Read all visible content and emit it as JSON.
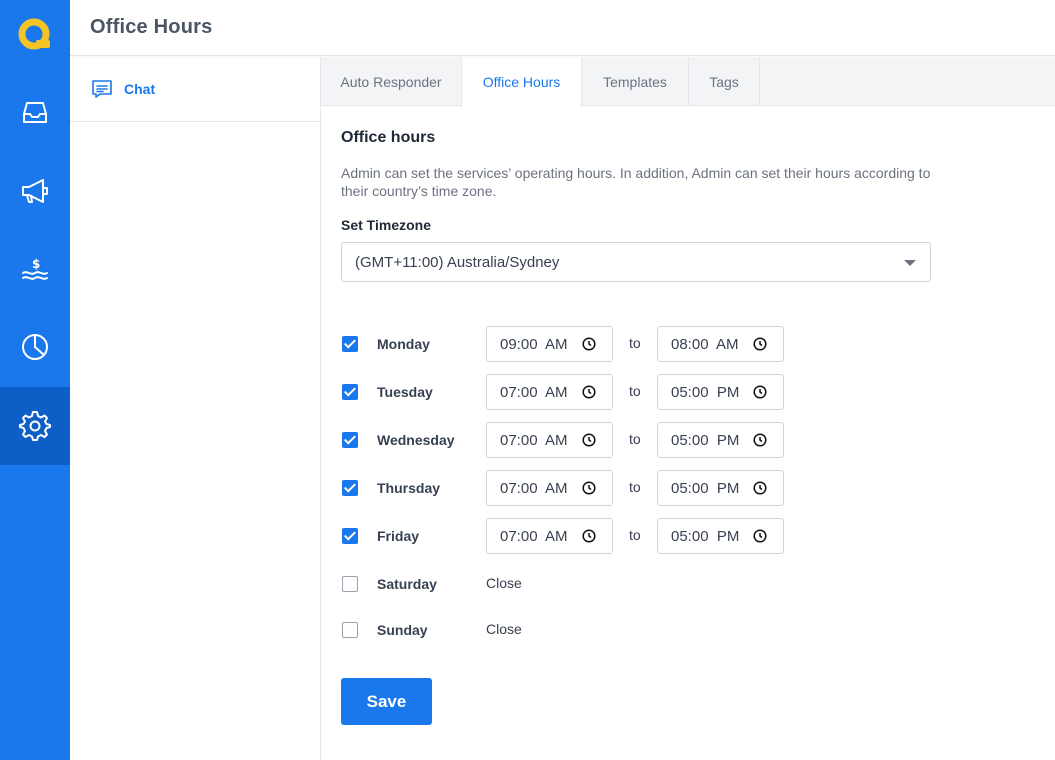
{
  "header": {
    "title": "Office Hours"
  },
  "rail": {
    "items": [
      {
        "icon": "inbox-icon"
      },
      {
        "icon": "megaphone-icon"
      },
      {
        "icon": "billing-icon"
      },
      {
        "icon": "pie-chart-icon"
      },
      {
        "icon": "gear-icon",
        "active": true
      }
    ]
  },
  "subnav": {
    "chat_label": "Chat"
  },
  "tabs": [
    {
      "label": "Auto Responder"
    },
    {
      "label": "Office Hours",
      "active": true
    },
    {
      "label": "Templates"
    },
    {
      "label": "Tags"
    }
  ],
  "main": {
    "title": "Office hours",
    "description": "Admin can set the services’ operating hours. In addition, Admin can set their hours according to their country’s time zone.",
    "timezone_label": "Set Timezone",
    "timezone_value": "(GMT+11:00) Australia/Sydney",
    "to_label": "to",
    "days": [
      {
        "name": "Monday",
        "checked": true,
        "from": "09:00  AM",
        "to": "08:00  AM"
      },
      {
        "name": "Tuesday",
        "checked": true,
        "from": "07:00  AM",
        "to": "05:00  PM"
      },
      {
        "name": "Wednesday",
        "checked": true,
        "from": "07:00  AM",
        "to": "05:00  PM"
      },
      {
        "name": "Thursday",
        "checked": true,
        "from": "07:00  AM",
        "to": "05:00  PM"
      },
      {
        "name": "Friday",
        "checked": true,
        "from": "07:00  AM",
        "to": "05:00  PM"
      },
      {
        "name": "Saturday",
        "checked": false,
        "status": "Close"
      },
      {
        "name": "Sunday",
        "checked": false,
        "status": "Close"
      }
    ],
    "save_label": "Save"
  },
  "colors": {
    "primary": "#1a78ec",
    "rail_active": "#0d5ec7",
    "logo_yellow": "#f6c327"
  }
}
